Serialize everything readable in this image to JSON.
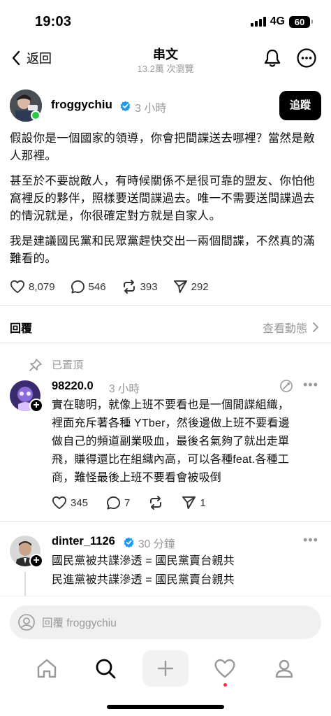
{
  "status_bar": {
    "time": "19:03",
    "network": "4G",
    "battery": "60"
  },
  "topbar": {
    "back_label": "返回",
    "title": "串文",
    "subtitle": "13.2萬 次瀏覽"
  },
  "post": {
    "username": "froggychiu",
    "time": "3 小時",
    "follow_label": "追蹤",
    "paragraphs": [
      "假設你是一個國家的領導，你會把間諜送去哪裡？當然是敵人那裡。",
      "甚至於不要說敵人，有時候關係不是很可靠的盟友、你怕他窩裡反的夥伴，照樣要送間諜過去。唯一不需要送間諜過去的情況就是，你很確定對方就是自家人。",
      "我是建議國民黨和民眾黨趕快交出一兩個間諜，不然真的滿難看的。"
    ],
    "likes": "8,079",
    "comments": "546",
    "reposts": "393",
    "shares": "292"
  },
  "replies_header": {
    "title": "回覆",
    "activity_label": "查看動態"
  },
  "pinned_label": "已置頂",
  "replies": [
    {
      "username": "98220.0",
      "time": "3 小時",
      "lines": [
        "實在聰明，就像上班不要看也是一個間諜組織，",
        "裡面充斥著各種 YTber，然後邊做上班不要看邊",
        "做自己的頻道副業吸血，最後名氣夠了就出走單",
        "飛，賺得還比在組織內高，可以各種feat.各種工",
        "商，難怪最後上班不要看會被吸倒"
      ],
      "likes": "345",
      "comments": "7",
      "shares": "1"
    },
    {
      "username": "dinter_1126",
      "time": "30 分鐘",
      "lines": [
        "國民黨被共諜滲透 = 國民黨賣台親共",
        "民進黨被共諜滲透 = 國民黨賣台親共"
      ]
    }
  ],
  "composer": {
    "placeholder": "回覆 froggychiu"
  },
  "colors": {
    "accent_blue": "#1d9bf0",
    "online_green": "#2ec946",
    "notification_red": "#ff3040"
  }
}
